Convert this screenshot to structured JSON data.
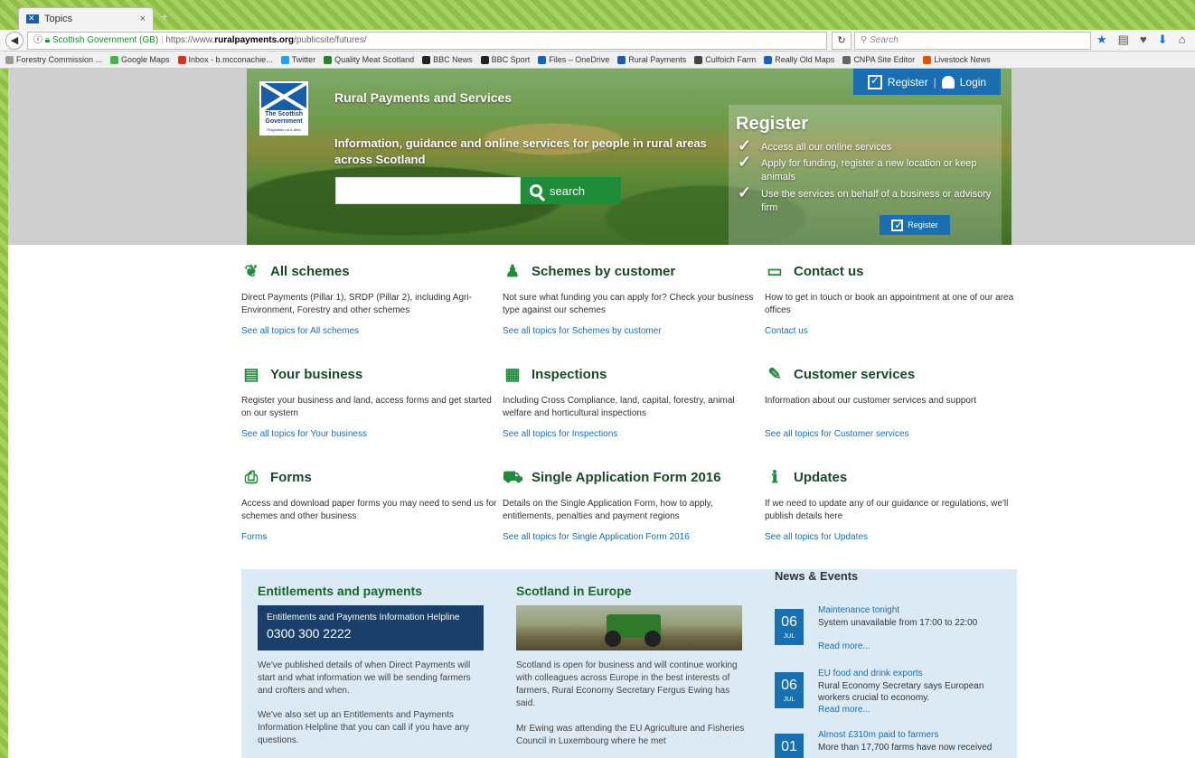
{
  "browser": {
    "tab_title": "Topics",
    "tab_close": "×",
    "new_tab": "+",
    "url_identity": "Scottish Government (GB)",
    "url_prefix": "https://www.",
    "url_host": "ruralpayments.org",
    "url_path": "/publicsite/futures/",
    "search_placeholder": "Search",
    "bookmarks": [
      {
        "label": "Forestry Commission ...",
        "color": "#999999"
      },
      {
        "label": "Google Maps",
        "color": "#4caf50"
      },
      {
        "label": "Inbox - b.mcconachie...",
        "color": "#d93025"
      },
      {
        "label": "Twitter",
        "color": "#1da1f2"
      },
      {
        "label": "Quality Meat Scotland",
        "color": "#2e7d32"
      },
      {
        "label": "BBC News",
        "color": "#222222"
      },
      {
        "label": "BBC Sport",
        "color": "#222222"
      },
      {
        "label": "Files – OneDrive",
        "color": "#1565c0"
      },
      {
        "label": "Rural Payments",
        "color": "#1a5ea8"
      },
      {
        "label": "Culfoich Farm",
        "color": "#444444"
      },
      {
        "label": "Really Old Maps",
        "color": "#1565c0"
      },
      {
        "label": "CNPA Site Editor",
        "color": "#666666"
      },
      {
        "label": "Livestock News",
        "color": "#e65100"
      }
    ]
  },
  "hero": {
    "logo_line1": "The Scottish",
    "logo_line2": "Government",
    "logo_line3": "Riaghaltas na h-Alba",
    "site_title": "Rural Payments and Services",
    "description": "Information, guidance and online services for people in rural areas across Scotland",
    "search_button": "search",
    "register_link": "Register",
    "login_link": "Login",
    "register_heading": "Register",
    "register_items": [
      "Access all our online services",
      "Apply for funding, register a new location or keep animals",
      "Use the services on behalf of a business or advisory firm"
    ],
    "register_button": "Register"
  },
  "topics": [
    {
      "title": "All schemes",
      "icon": "leaf-icon",
      "glyph": "❦",
      "desc": "Direct Payments (Pillar 1), SRDP (Pillar 2), including Agri-Environment, Forestry and other schemes",
      "link": "See all topics for All schemes"
    },
    {
      "title": "Schemes by customer",
      "icon": "people-icon",
      "glyph": "♟",
      "desc": "Not sure what funding you can apply for? Check your business type against our schemes",
      "link": "See all topics for Schemes by customer"
    },
    {
      "title": "Contact us",
      "icon": "devices-icon",
      "glyph": "▭",
      "desc": "How to get in touch or book an appointment at one of our area offices",
      "link": "Contact us"
    },
    {
      "title": "Your business",
      "icon": "ledger-icon",
      "glyph": "▤",
      "desc": "Register your business and land, access forms and get started on our system",
      "link": "See all topics for Your business"
    },
    {
      "title": "Inspections",
      "icon": "map-icon",
      "glyph": "▦",
      "desc": "Including Cross Compliance, land, capital, forestry, animal welfare and horticultural inspections",
      "link": "See all topics for Inspections"
    },
    {
      "title": "Customer services",
      "icon": "edit-icon",
      "glyph": "✎",
      "desc": "Information about our customer services and support",
      "link": "See all topics for Customer services"
    },
    {
      "title": "Forms",
      "icon": "printer-icon",
      "glyph": "⎙",
      "desc": "Access and download paper forms you may need to send us for schemes and other business",
      "link": "Forms"
    },
    {
      "title": "Single Application Form 2016",
      "icon": "tractor-icon",
      "glyph": "⛟",
      "desc": "Details on the Single Application Form, how to apply, entitlements, penalties and payment regions",
      "link": "See all topics for Single Application Form 2016"
    },
    {
      "title": "Updates",
      "icon": "info-icon",
      "glyph": "ℹ",
      "desc": "If we need to update any of our guidance or regulations, we'll publish details here",
      "link": "See all topics for Updates"
    }
  ],
  "bottom": {
    "entitlements": {
      "heading": "Entitlements and payments",
      "helpline_title": "Entitlements and Payments Information Helpline",
      "helpline_number": "0300 300 2222",
      "para1": "We've published details of when Direct Payments will start and what information we will be sending farmers and crofters and when.",
      "para2": "We've also set up an Entitlements and Payments Information Helpline that you can call if you have any questions."
    },
    "europe": {
      "heading": "Scotland in Europe",
      "para1": "Scotland is open for business and will continue working with colleagues across Europe in the best interests of farmers, Rural Economy Secretary Fergus Ewing has said.",
      "para2": "Mr Ewing was attending the EU Agriculture and Fisheries Council in Luxembourg where he met"
    },
    "news": {
      "heading": "News & Events",
      "items": [
        {
          "day": "06",
          "month": "JUL",
          "title": "Maintenance tonight",
          "body": "System unavailable from 17:00 to 22:00",
          "more": "Read more..."
        },
        {
          "day": "06",
          "month": "JUL",
          "title": "EU food and drink exports",
          "body": "Rural Economy Secretary says European workers crucial to economy.",
          "more": "Read more..."
        },
        {
          "day": "01",
          "month": "",
          "title": "Almost £310m paid to farmers",
          "body": "More than 17,700 farms have now received",
          "more": ""
        }
      ]
    }
  }
}
